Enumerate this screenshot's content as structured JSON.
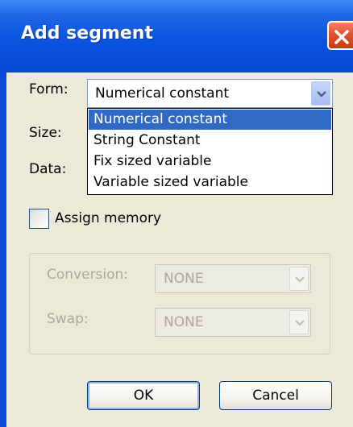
{
  "window": {
    "title": "Add segment",
    "close_icon": "close-icon"
  },
  "form": {
    "label": "Form:",
    "selected_value": "Numerical constant",
    "options": [
      "Numerical constant",
      "String Constant",
      "Fix sized variable",
      "Variable sized variable"
    ],
    "selected_index": 0
  },
  "size": {
    "label": "Size:"
  },
  "data": {
    "label": "Data:"
  },
  "assign_memory": {
    "label": "Assign memory",
    "checked": false
  },
  "conversion": {
    "label": "Conversion:",
    "value": "NONE",
    "enabled": false
  },
  "swap": {
    "label": "Swap:",
    "value": "NONE",
    "enabled": false
  },
  "buttons": {
    "ok": "OK",
    "cancel": "Cancel"
  },
  "colors": {
    "titlebar": "#0a54e0",
    "dialog_bg": "#ece9d8",
    "selection": "#316ac5",
    "disabled_text": "#aca899",
    "close_button": "#e0522a"
  }
}
